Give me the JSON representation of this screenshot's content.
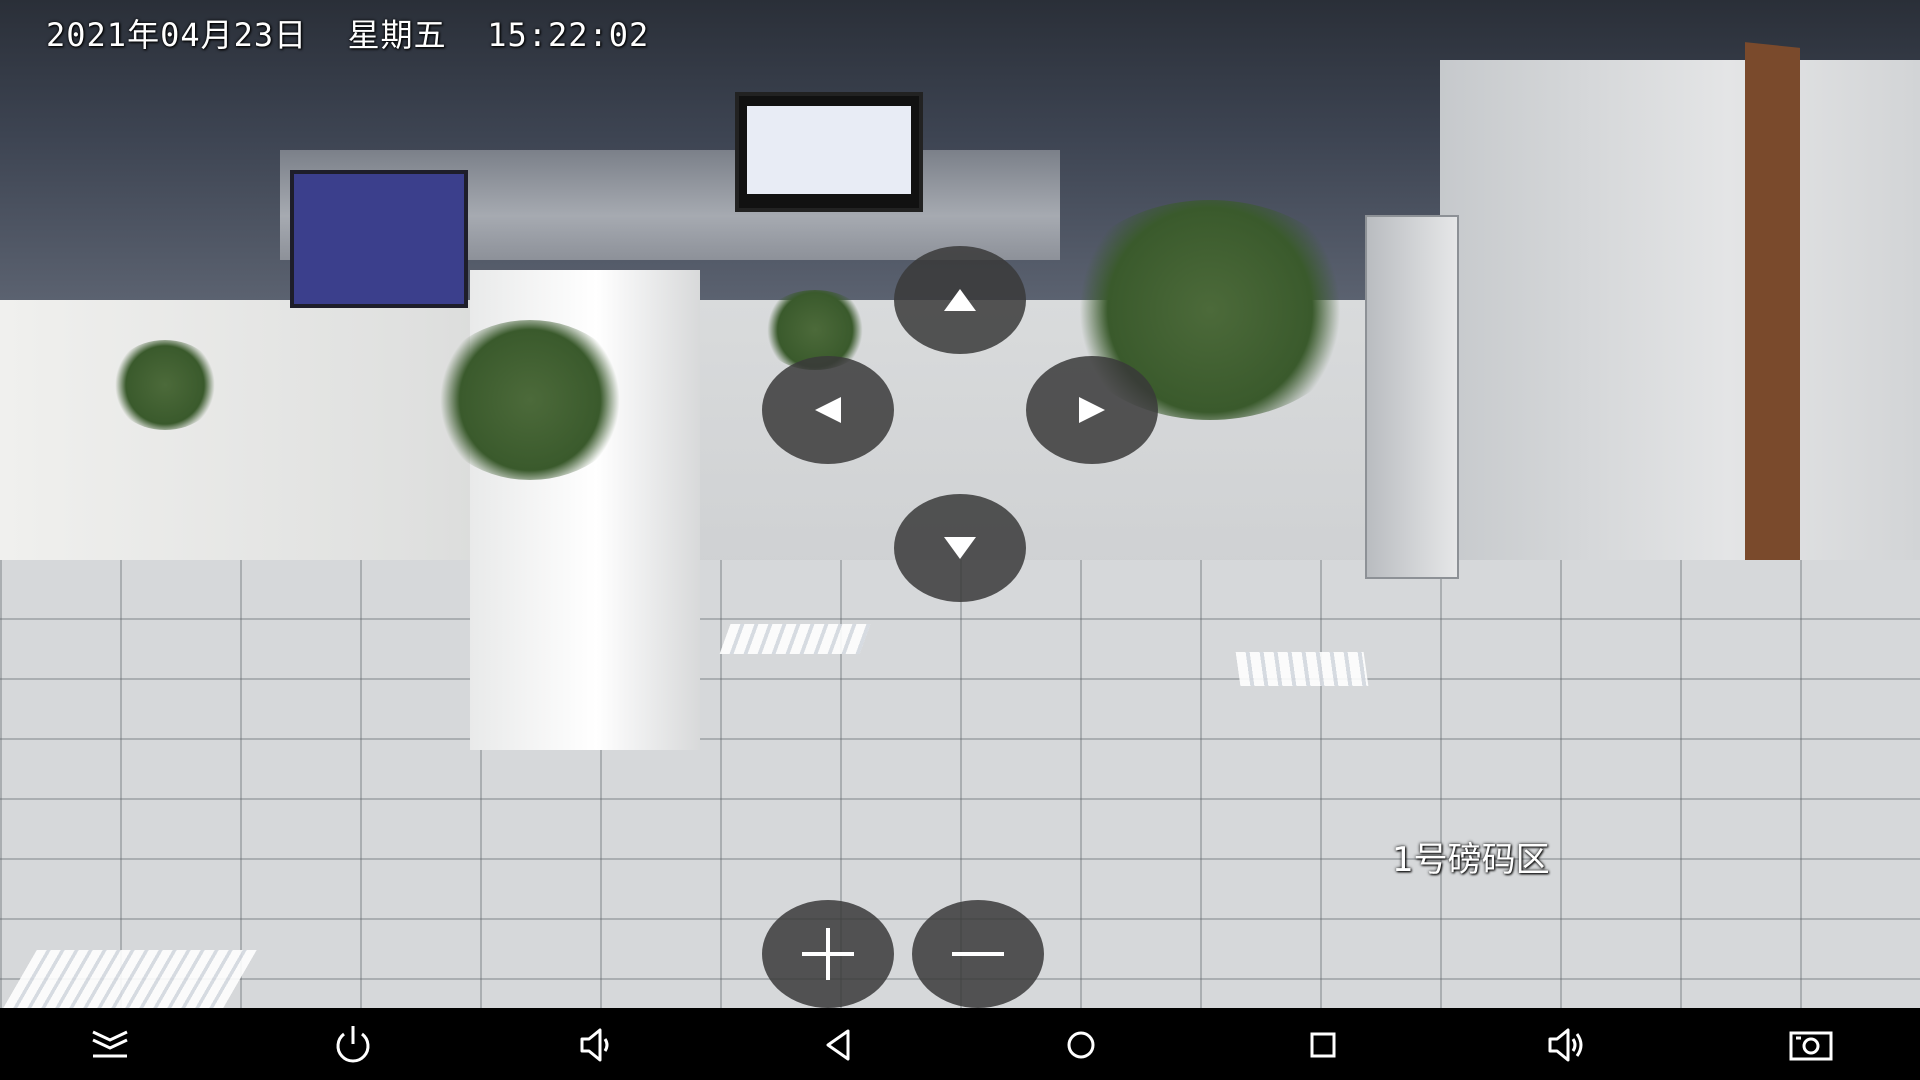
{
  "overlay": {
    "datetime": "2021年04月23日  星期五  15:22:02",
    "zone_label": "1号磅码区"
  },
  "ptz_controls": {
    "up": "arrow-up-icon",
    "down": "arrow-down-icon",
    "left": "arrow-left-icon",
    "right": "arrow-right-icon",
    "zoom_in": "plus-icon",
    "zoom_out": "minus-icon"
  },
  "navbar": {
    "buttons": [
      "collapse-icon",
      "power-icon",
      "volume-down-icon",
      "back-icon",
      "home-icon",
      "recents-icon",
      "volume-up-icon",
      "screenshot-icon"
    ]
  },
  "colors": {
    "control_bg": "#3a3a3a",
    "control_fg": "#ffffff",
    "navbar_bg": "#000000"
  }
}
